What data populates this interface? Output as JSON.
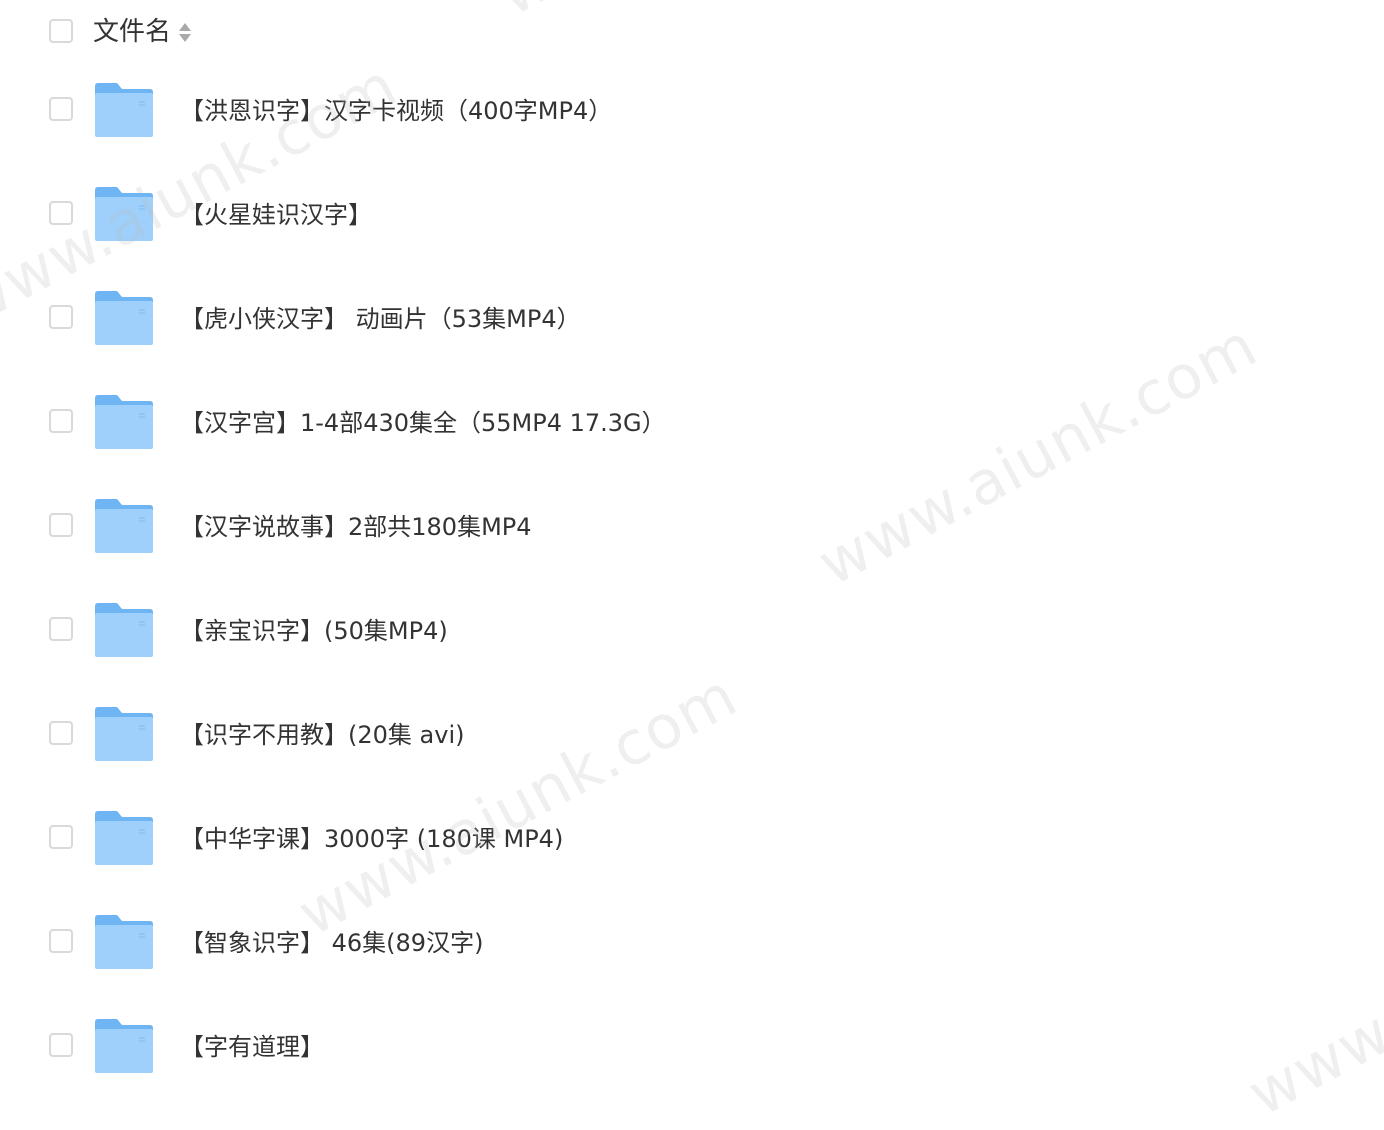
{
  "header": {
    "title": "文件名"
  },
  "files": [
    {
      "name": "【洪恩识字】汉字卡视频（400字MP4）"
    },
    {
      "name": "【火星娃识汉字】"
    },
    {
      "name": "【虎小侠汉字】 动画片（53集MP4）"
    },
    {
      "name": "【汉字宫】1-4部430集全（55MP4 17.3G）"
    },
    {
      "name": "【汉字说故事】2部共180集MP4"
    },
    {
      "name": "【亲宝识字】(50集MP4)"
    },
    {
      "name": "【识字不用教】(20集 avi)"
    },
    {
      "name": "【中华字课】3000字 (180课 MP4)"
    },
    {
      "name": "【智象识字】 46集(89汉字)"
    },
    {
      "name": "【字有道理】"
    }
  ],
  "watermarks": {
    "w1": "www.aiunk.com",
    "w2": "www.aiunk.com",
    "w3": "www.aiunk.com",
    "w4": "www.aiunk.com",
    "w5": "www.aiunk.com"
  },
  "colors": {
    "folder_light": "#9fd0fb",
    "folder_dark": "#6fb4f3",
    "checkbox_border": "#d9d9d9",
    "text": "#333333"
  },
  "icons": {
    "folder": "folder-icon",
    "sort": "sort-icon"
  }
}
